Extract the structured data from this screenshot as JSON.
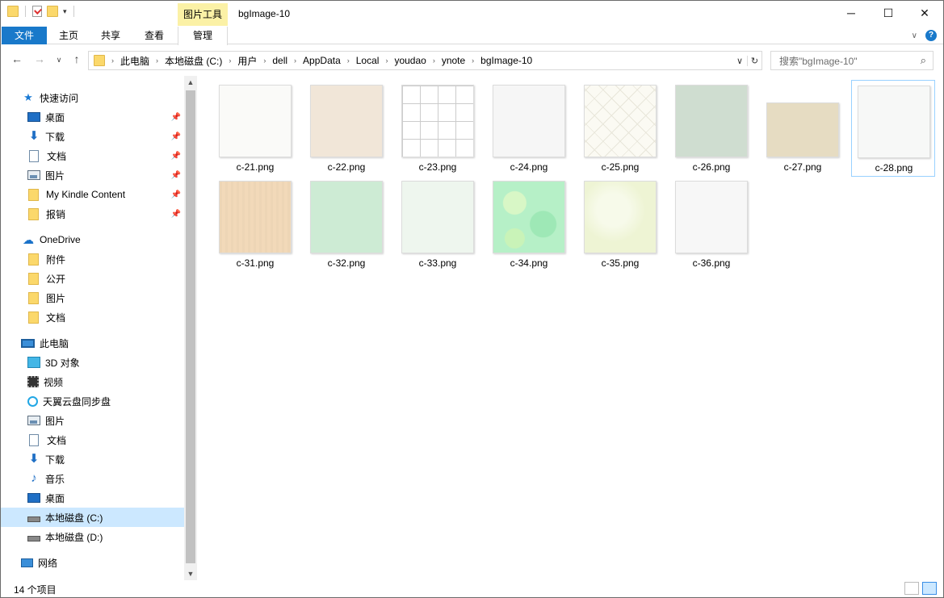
{
  "window": {
    "title": "bgImage-10",
    "context_tab": "图片工具"
  },
  "ribbon": {
    "tabs": [
      "文件",
      "主页",
      "共享",
      "查看",
      "管理"
    ]
  },
  "address": {
    "crumbs": [
      "此电脑",
      "本地磁盘 (C:)",
      "用户",
      "dell",
      "AppData",
      "Local",
      "youdao",
      "ynote",
      "bgImage-10"
    ]
  },
  "search": {
    "placeholder": "搜索\"bgImage-10\""
  },
  "nav": {
    "quick_access": "快速访问",
    "quick_items": [
      {
        "label": "桌面",
        "icon": "desktop-icon"
      },
      {
        "label": "下载",
        "icon": "download-icon"
      },
      {
        "label": "文档",
        "icon": "document-icon"
      },
      {
        "label": "图片",
        "icon": "pictures-icon"
      },
      {
        "label": "My Kindle Content",
        "icon": "folder-icon"
      },
      {
        "label": "报销",
        "icon": "folder-icon"
      }
    ],
    "onedrive": "OneDrive",
    "onedrive_items": [
      "附件",
      "公开",
      "图片",
      "文档"
    ],
    "this_pc": "此电脑",
    "pc_items": [
      {
        "label": "3D 对象",
        "icon": "3d-objects-icon"
      },
      {
        "label": "视频",
        "icon": "video-icon"
      },
      {
        "label": "天翼云盘同步盘",
        "icon": "sync-icon"
      },
      {
        "label": "图片",
        "icon": "pictures-icon"
      },
      {
        "label": "文档",
        "icon": "document-icon"
      },
      {
        "label": "下载",
        "icon": "download-icon"
      },
      {
        "label": "音乐",
        "icon": "music-icon"
      },
      {
        "label": "桌面",
        "icon": "desktop-icon"
      },
      {
        "label": "本地磁盘 (C:)",
        "icon": "drive-icon"
      },
      {
        "label": "本地磁盘 (D:)",
        "icon": "drive-icon"
      }
    ],
    "network": "网络"
  },
  "files": [
    {
      "name": "c-21.png",
      "color": "#fafaf8"
    },
    {
      "name": "c-22.png",
      "color": "#f1e6d8"
    },
    {
      "name": "c-23.png",
      "color": "#ffffff"
    },
    {
      "name": "c-24.png",
      "color": "#f6f6f6"
    },
    {
      "name": "c-25.png",
      "color": "#fbfaf3"
    },
    {
      "name": "c-26.png",
      "color": "#cfddd0"
    },
    {
      "name": "c-27.png",
      "color": "#e6dcc2"
    },
    {
      "name": "c-28.png",
      "color": "#f7f8f7"
    },
    {
      "name": "c-31.png",
      "color": "#f2d9b9"
    },
    {
      "name": "c-32.png",
      "color": "#cdebd4"
    },
    {
      "name": "c-33.png",
      "color": "#eef6ee"
    },
    {
      "name": "c-34.png",
      "color": "#b6f0c7"
    },
    {
      "name": "c-35.png",
      "color": "#eef4d4"
    },
    {
      "name": "c-36.png",
      "color": "#f7f7f7"
    }
  ],
  "status": {
    "count": "14 个项目"
  }
}
